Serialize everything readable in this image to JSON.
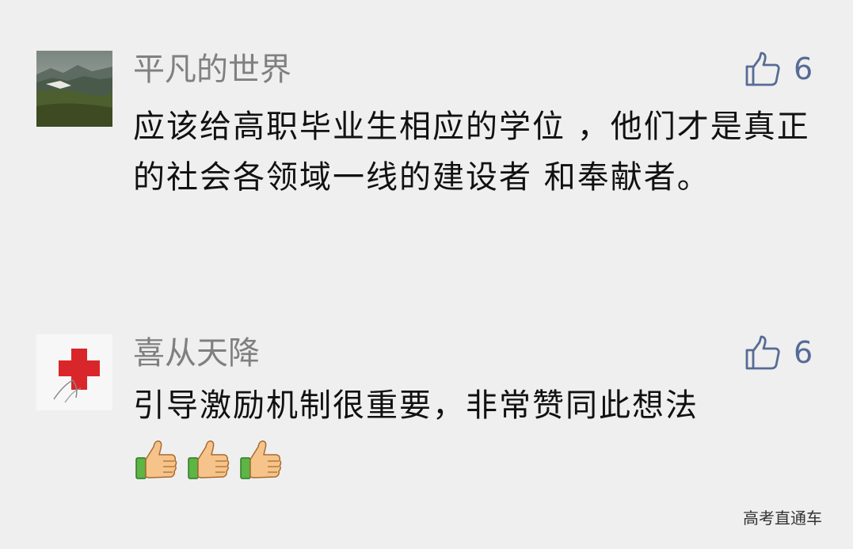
{
  "comments": [
    {
      "avatar": "mountain-landscape-avatar",
      "nickname": "平凡的世界",
      "like_icon": "thumbs-up-outline-icon",
      "likes": "6",
      "text": "应该给高职毕业生相应的学位 ，他们才是真正的社会各领域一线的建设者 和奉献者。"
    },
    {
      "avatar": "red-cross-avatar",
      "nickname": "喜从天降",
      "like_icon": "thumbs-up-outline-icon",
      "likes": "6",
      "text": "引导激励机制很重要，非常赞同此想法",
      "emojis": [
        "thumbs-up-emoji",
        "thumbs-up-emoji",
        "thumbs-up-emoji"
      ]
    }
  ],
  "watermark": "高考直通车",
  "colors": {
    "background": "#efefef",
    "nickname": "#808080",
    "like": "#576b95",
    "text": "#111111",
    "cross": "#d9262a"
  }
}
